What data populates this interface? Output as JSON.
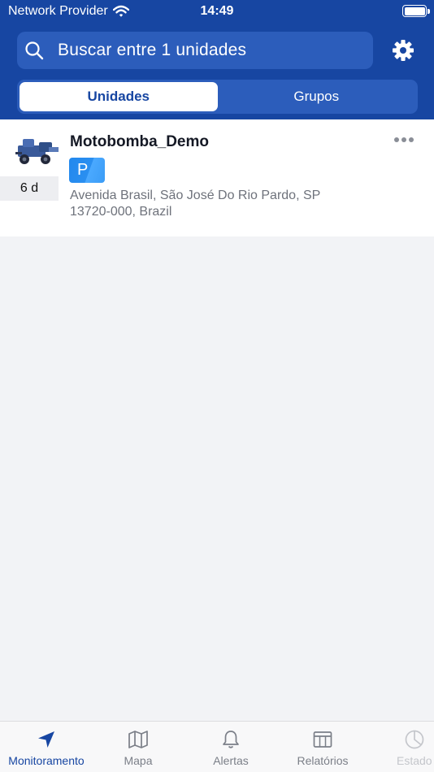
{
  "status_bar": {
    "carrier": "Network Provider",
    "time": "14:49"
  },
  "search": {
    "placeholder": "Buscar entre 1 unidades"
  },
  "segments": [
    {
      "label": "Unidades",
      "selected": true
    },
    {
      "label": "Grupos",
      "selected": false
    }
  ],
  "unit": {
    "name": "Motobomba_Demo",
    "last_message_age": "6 d",
    "state_badge": "P",
    "address_line1": "Avenida Brasil, São José Do Rio Pardo, SP",
    "address_line2": "13720-000, Brazil"
  },
  "tab_bar": {
    "items": [
      {
        "label": "Monitoramento",
        "icon": "navigation-arrow-icon",
        "active": true
      },
      {
        "label": "Mapa",
        "icon": "map-icon",
        "active": false
      },
      {
        "label": "Alertas",
        "icon": "bell-icon",
        "active": false
      },
      {
        "label": "Relatórios",
        "icon": "table-icon",
        "active": false
      },
      {
        "label": "Estado",
        "icon": "pie-chart-icon",
        "active": false
      }
    ]
  },
  "colors": {
    "brand": "#1746a2",
    "search_bg": "#2c5dbb",
    "badge": "#2288ee",
    "background": "#f2f3f6"
  }
}
